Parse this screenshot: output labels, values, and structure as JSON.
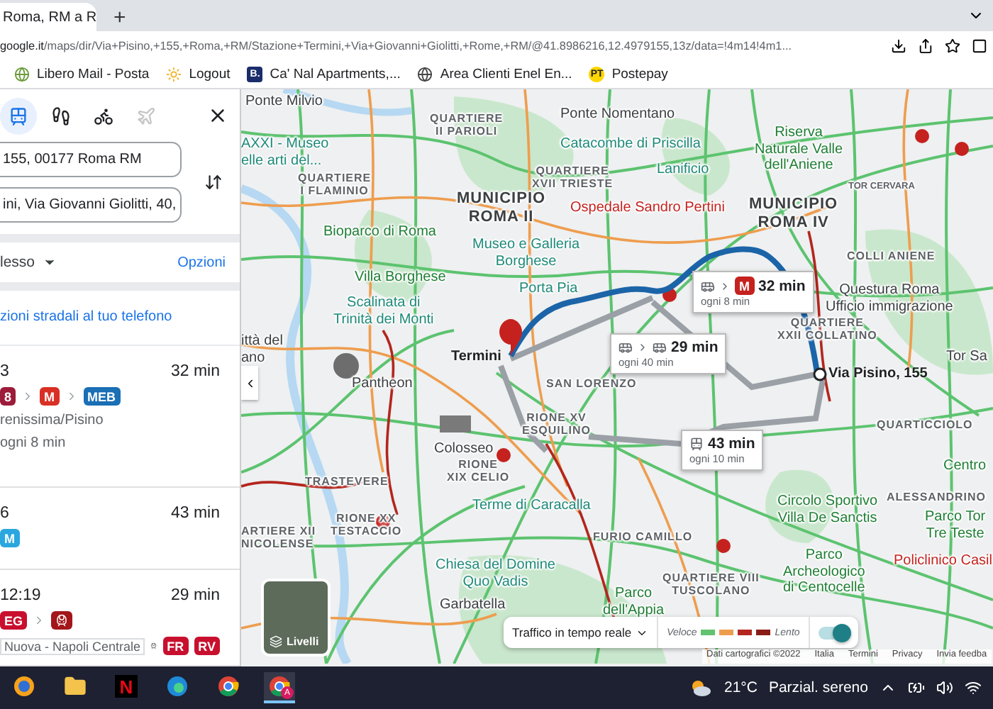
{
  "browser": {
    "tab_title": "Roma, RM a R",
    "new_tab": "+",
    "url": "**google.it**/maps/dir/Via+Pisino,+155,+Roma,+RM/Stazione+Termini,+Via+Giovanni+Giolitti,+Rome,+RM/@41.8986216,12.4979155,13z/data=!4m14!4m1...",
    "bookmarks": [
      {
        "label": "Libero Mail - Posta",
        "kind": "globe"
      },
      {
        "label": "Logout",
        "kind": "sun"
      },
      {
        "label": "Ca' Nal Apartments,...",
        "kind": "letter",
        "badge": "B."
      },
      {
        "label": "Area Clienti Enel En...",
        "kind": "world"
      },
      {
        "label": "Postepay",
        "kind": "letter-round",
        "badge": "PT"
      }
    ]
  },
  "directions": {
    "modes": [
      {
        "kind": "transit",
        "selected": true,
        "disabled": false
      },
      {
        "kind": "walk",
        "selected": false,
        "disabled": false
      },
      {
        "kind": "bike",
        "selected": false,
        "disabled": false
      },
      {
        "kind": "flight",
        "selected": false,
        "disabled": true
      }
    ],
    "origin": "155, 00177 Roma RM",
    "destination": "ini, Via Giovanni Giolitti, 40,",
    "depart": "lesso",
    "options": "Opzioni",
    "send_link": "zioni stradali al tuo telefono",
    "routes": [
      {
        "time": "3",
        "duration": "32 min",
        "steps": [
          {
            "kind": "line",
            "text": "8",
            "color": "#9c1c3a"
          },
          {
            "kind": "metro",
            "text": "M",
            "color": "#d93025"
          },
          {
            "kind": "line",
            "text": "MEB",
            "color": "#1a6fb5"
          }
        ],
        "stop": "renissima/Pisino",
        "frequency": "ogni 8 min"
      },
      {
        "time": "6",
        "duration": "43 min",
        "steps": [
          {
            "kind": "line",
            "text": "M",
            "color": "#2aa7df"
          }
        ]
      },
      {
        "time": "12:19",
        "duration": "29 min",
        "steps": [
          {
            "kind": "line",
            "text": "EG",
            "color": "#c8102e"
          },
          {
            "kind": "train",
            "color": "#a3161a"
          }
        ],
        "stop": "Nuova - Napoli Centrale",
        "services": [
          {
            "text": "FR",
            "color": "#c8102e"
          },
          {
            "text": "RV",
            "color": "#c8102e"
          }
        ]
      }
    ]
  },
  "map": {
    "labels": [
      {
        "kind": "place",
        "lines": [
          "Ponte Milvio"
        ]
      },
      {
        "kind": "attraction",
        "lines": [
          "AXXI - Museo",
          "elle arti del..."
        ]
      },
      {
        "kind": "district",
        "lines": [
          "QUARTIERE",
          "II PARIOLI"
        ]
      },
      {
        "kind": "place",
        "lines": [
          "Ponte Nomentano"
        ]
      },
      {
        "kind": "attraction",
        "lines": [
          "Catacombe di Priscilla"
        ]
      },
      {
        "kind": "park",
        "lines": [
          "Riserva",
          "Naturale Valle",
          "dell'Aniene"
        ]
      },
      {
        "kind": "district",
        "lines": [
          "QUARTIERE",
          "I FLAMINIO"
        ]
      },
      {
        "kind": "district",
        "lines": [
          "QUARTIERE",
          "XVII TRIESTE"
        ]
      },
      {
        "kind": "attraction",
        "lines": [
          "Lanificio"
        ]
      },
      {
        "kind": "small",
        "lines": [
          "TOR CERVARA"
        ]
      },
      {
        "kind": "municipio",
        "lines": [
          "MUNICIPIO",
          "ROMA II"
        ]
      },
      {
        "kind": "health",
        "lines": [
          "Ospedale Sandro Pertini"
        ]
      },
      {
        "kind": "municipio",
        "lines": [
          "MUNICIPIO",
          "ROMA IV"
        ]
      },
      {
        "kind": "park",
        "lines": [
          "Bioparco di Roma"
        ]
      },
      {
        "kind": "attraction",
        "lines": [
          "Museo e Galleria",
          "Borghese"
        ]
      },
      {
        "kind": "district",
        "lines": [
          "COLLI ANIENE"
        ]
      },
      {
        "kind": "park",
        "lines": [
          "Villa Borghese"
        ]
      },
      {
        "kind": "attraction",
        "lines": [
          "Porta Pia"
        ]
      },
      {
        "kind": "place",
        "lines": [
          "Questura Roma",
          "Ufficio immigrazione"
        ]
      },
      {
        "kind": "attraction",
        "lines": [
          "Scalinata di",
          "Trinità dei Monti"
        ]
      },
      {
        "kind": "district",
        "lines": [
          "QUARTIERE",
          "XXII COLLATINO"
        ]
      },
      {
        "kind": "place",
        "lines": [
          "ittà del",
          "ano"
        ]
      },
      {
        "kind": "place",
        "lines": [
          "Tor Sa"
        ]
      },
      {
        "kind": "place",
        "lines": [
          "Pantheon"
        ]
      },
      {
        "kind": "district",
        "lines": [
          "SAN LORENZO"
        ]
      },
      {
        "kind": "district",
        "lines": [
          "RIONE XV",
          "ESQUILINO"
        ]
      },
      {
        "kind": "district",
        "lines": [
          "QUARTICCIOLO"
        ]
      },
      {
        "kind": "place",
        "lines": [
          "Colosseo"
        ]
      },
      {
        "kind": "district",
        "lines": [
          "RIONE",
          "XIX CELIO"
        ]
      },
      {
        "kind": "park",
        "lines": [
          "Centro"
        ]
      },
      {
        "kind": "district",
        "lines": [
          "TRASTEVERE"
        ]
      },
      {
        "kind": "district",
        "lines": [
          "ARTIERE XII",
          "NICOLENSE"
        ]
      },
      {
        "kind": "district",
        "lines": [
          "RIONE XX",
          "TESTACCIO"
        ]
      },
      {
        "kind": "attraction",
        "lines": [
          "Terme di Caracalla"
        ]
      },
      {
        "kind": "district",
        "lines": [
          "FURIO CAMILLO"
        ]
      },
      {
        "kind": "park",
        "lines": [
          "Circolo Sportivo",
          "Villa De Sanctis"
        ]
      },
      {
        "kind": "district",
        "lines": [
          "ALESSANDRINO"
        ]
      },
      {
        "kind": "park",
        "lines": [
          "Parco Tor",
          "Tre Teste"
        ]
      },
      {
        "kind": "attraction",
        "lines": [
          "Chiesa del Domine",
          "Quo Vadis"
        ]
      },
      {
        "kind": "place",
        "lines": [
          "Garbatella"
        ]
      },
      {
        "kind": "park",
        "lines": [
          "Parco",
          "dell'Appia"
        ]
      },
      {
        "kind": "district",
        "lines": [
          "QUARTIERE VIII",
          "TUSCOLANO"
        ]
      },
      {
        "kind": "park",
        "lines": [
          "Parco",
          "Archeologico",
          "di Centocelle"
        ]
      },
      {
        "kind": "health",
        "lines": [
          "Policlinico Casil"
        ]
      }
    ],
    "callouts": [
      {
        "kind": "metro",
        "badge": "M",
        "duration": "32 min",
        "frequency": "ogni 8 min"
      },
      {
        "kind": "bus",
        "duration": "29 min",
        "frequency": "ogni 40 min"
      },
      {
        "kind": "tram",
        "duration": "43 min",
        "frequency": "ogni 10 min"
      }
    ],
    "destination": "Termini",
    "origin": "Via Pisino, 155",
    "layers": "Livelli",
    "traffic": {
      "label": "Traffico in tempo reale",
      "fast": "Veloce",
      "slow": "Lento",
      "on": true
    },
    "attribution": [
      "Dati cartografici ©2022",
      "Italia",
      "Termini",
      "Privacy",
      "Invia feedba"
    ]
  },
  "taskbar": {
    "apps": [
      {
        "kind": "shield",
        "selected": false
      },
      {
        "kind": "folder",
        "selected": false
      },
      {
        "kind": "netflix",
        "letter": "N",
        "selected": false
      },
      {
        "kind": "edge",
        "selected": false
      },
      {
        "kind": "chrome",
        "selected": false
      },
      {
        "kind": "chrome-profile",
        "letter": "A",
        "selected": true
      }
    ],
    "temperature": "21°C",
    "weather": "Parzial. sereno"
  }
}
